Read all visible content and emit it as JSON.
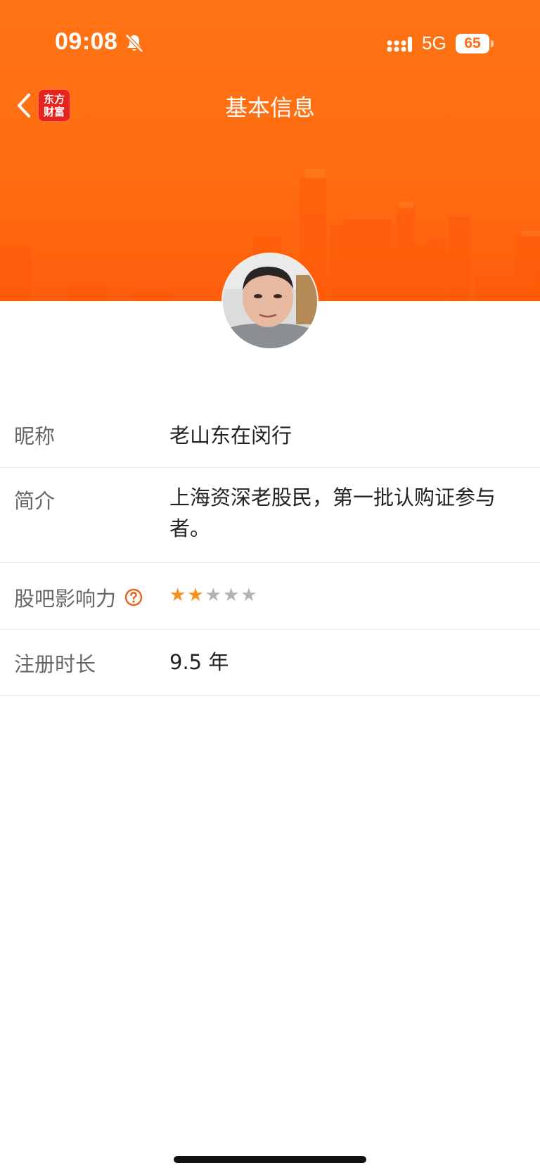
{
  "status_bar": {
    "time": "09:08",
    "network": "5G",
    "battery": "65",
    "battery_fraction": 0.65,
    "icons": [
      "bell-muted-icon",
      "signal-icon",
      "battery-icon"
    ]
  },
  "nav": {
    "title": "基本信息",
    "back_icon": "chevron-left-icon",
    "logo_text": [
      "东方",
      "财富"
    ]
  },
  "colors": {
    "header": "#ff6d12",
    "accent": "#f7901e",
    "help_icon": "#e8611c",
    "star_off": "#b3b3b3"
  },
  "profile": {
    "rows": [
      {
        "label": "昵称",
        "value": "老山东在闵行"
      },
      {
        "label": "简介",
        "value": "上海资深老股民，第一批认购证参与者。"
      },
      {
        "label": "股吧影响力",
        "rating": 2,
        "rating_max": 5
      },
      {
        "label": "注册时长",
        "value": "9.5 年"
      }
    ]
  }
}
